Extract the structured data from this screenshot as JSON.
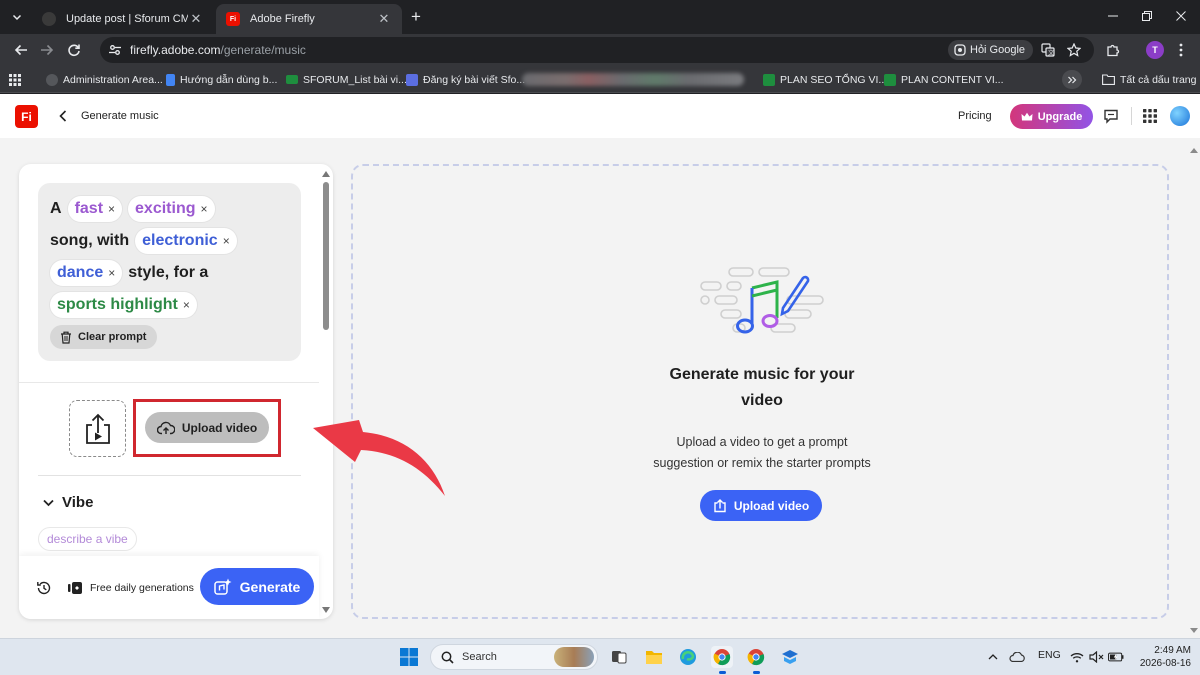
{
  "browser": {
    "tabs": [
      {
        "title": "Update post | Sforum CMS",
        "active": false
      },
      {
        "title": "Adobe Firefly",
        "favicon_text": "Fi",
        "active": true
      }
    ],
    "url_host": "firefly.adobe.com",
    "url_path": "/generate/music",
    "lens_label": "Hỏi Google",
    "profile_initial": "T",
    "bookmarks": [
      "Administration Area...",
      "Hướng dẫn dùng b...",
      "SFORUM_List bài vi...",
      "Đăng ký bài viết Sfo...",
      "PLAN SEO TỔNG VI...",
      "PLAN CONTENT VI..."
    ],
    "bookmarks_folder": "Tất cả dấu trang"
  },
  "app": {
    "logo_text": "Fi",
    "page_title": "Generate music",
    "pricing_label": "Pricing",
    "upgrade_label": "Upgrade",
    "prompt": {
      "word_a": "A",
      "chip_fast": "fast",
      "chip_exciting": "exciting",
      "text_song_with": "song, with",
      "chip_electronic": "electronic",
      "chip_dance": "dance",
      "text_style_for_a": "style, for a",
      "chip_sports": "sports highlight",
      "remove_glyph": "×"
    },
    "clear_prompt_label": "Clear prompt",
    "upload_video_label": "Upload video",
    "vibe_label": "Vibe",
    "vibe_placeholder": "describe a vibe",
    "free_generations_label": "Free daily generations",
    "generate_label": "Generate",
    "canvas": {
      "title_line1": "Generate music for your",
      "title_line2": "video",
      "desc_line1": "Upload a video to get a prompt",
      "desc_line2": "suggestion or remix the starter prompts",
      "upload_label": "Upload video"
    }
  },
  "taskbar": {
    "search_label": "Search",
    "language": "ENG",
    "time": "2:49 AM",
    "date": "2026-08-16"
  },
  "colors": {
    "accent_blue": "#3b63f5",
    "adobe_red": "#eb1000",
    "highlight_red": "#d0272f",
    "chip_purple": "#9b59d0",
    "chip_blue": "#3f5fd6",
    "chip_green": "#2d8a46"
  }
}
